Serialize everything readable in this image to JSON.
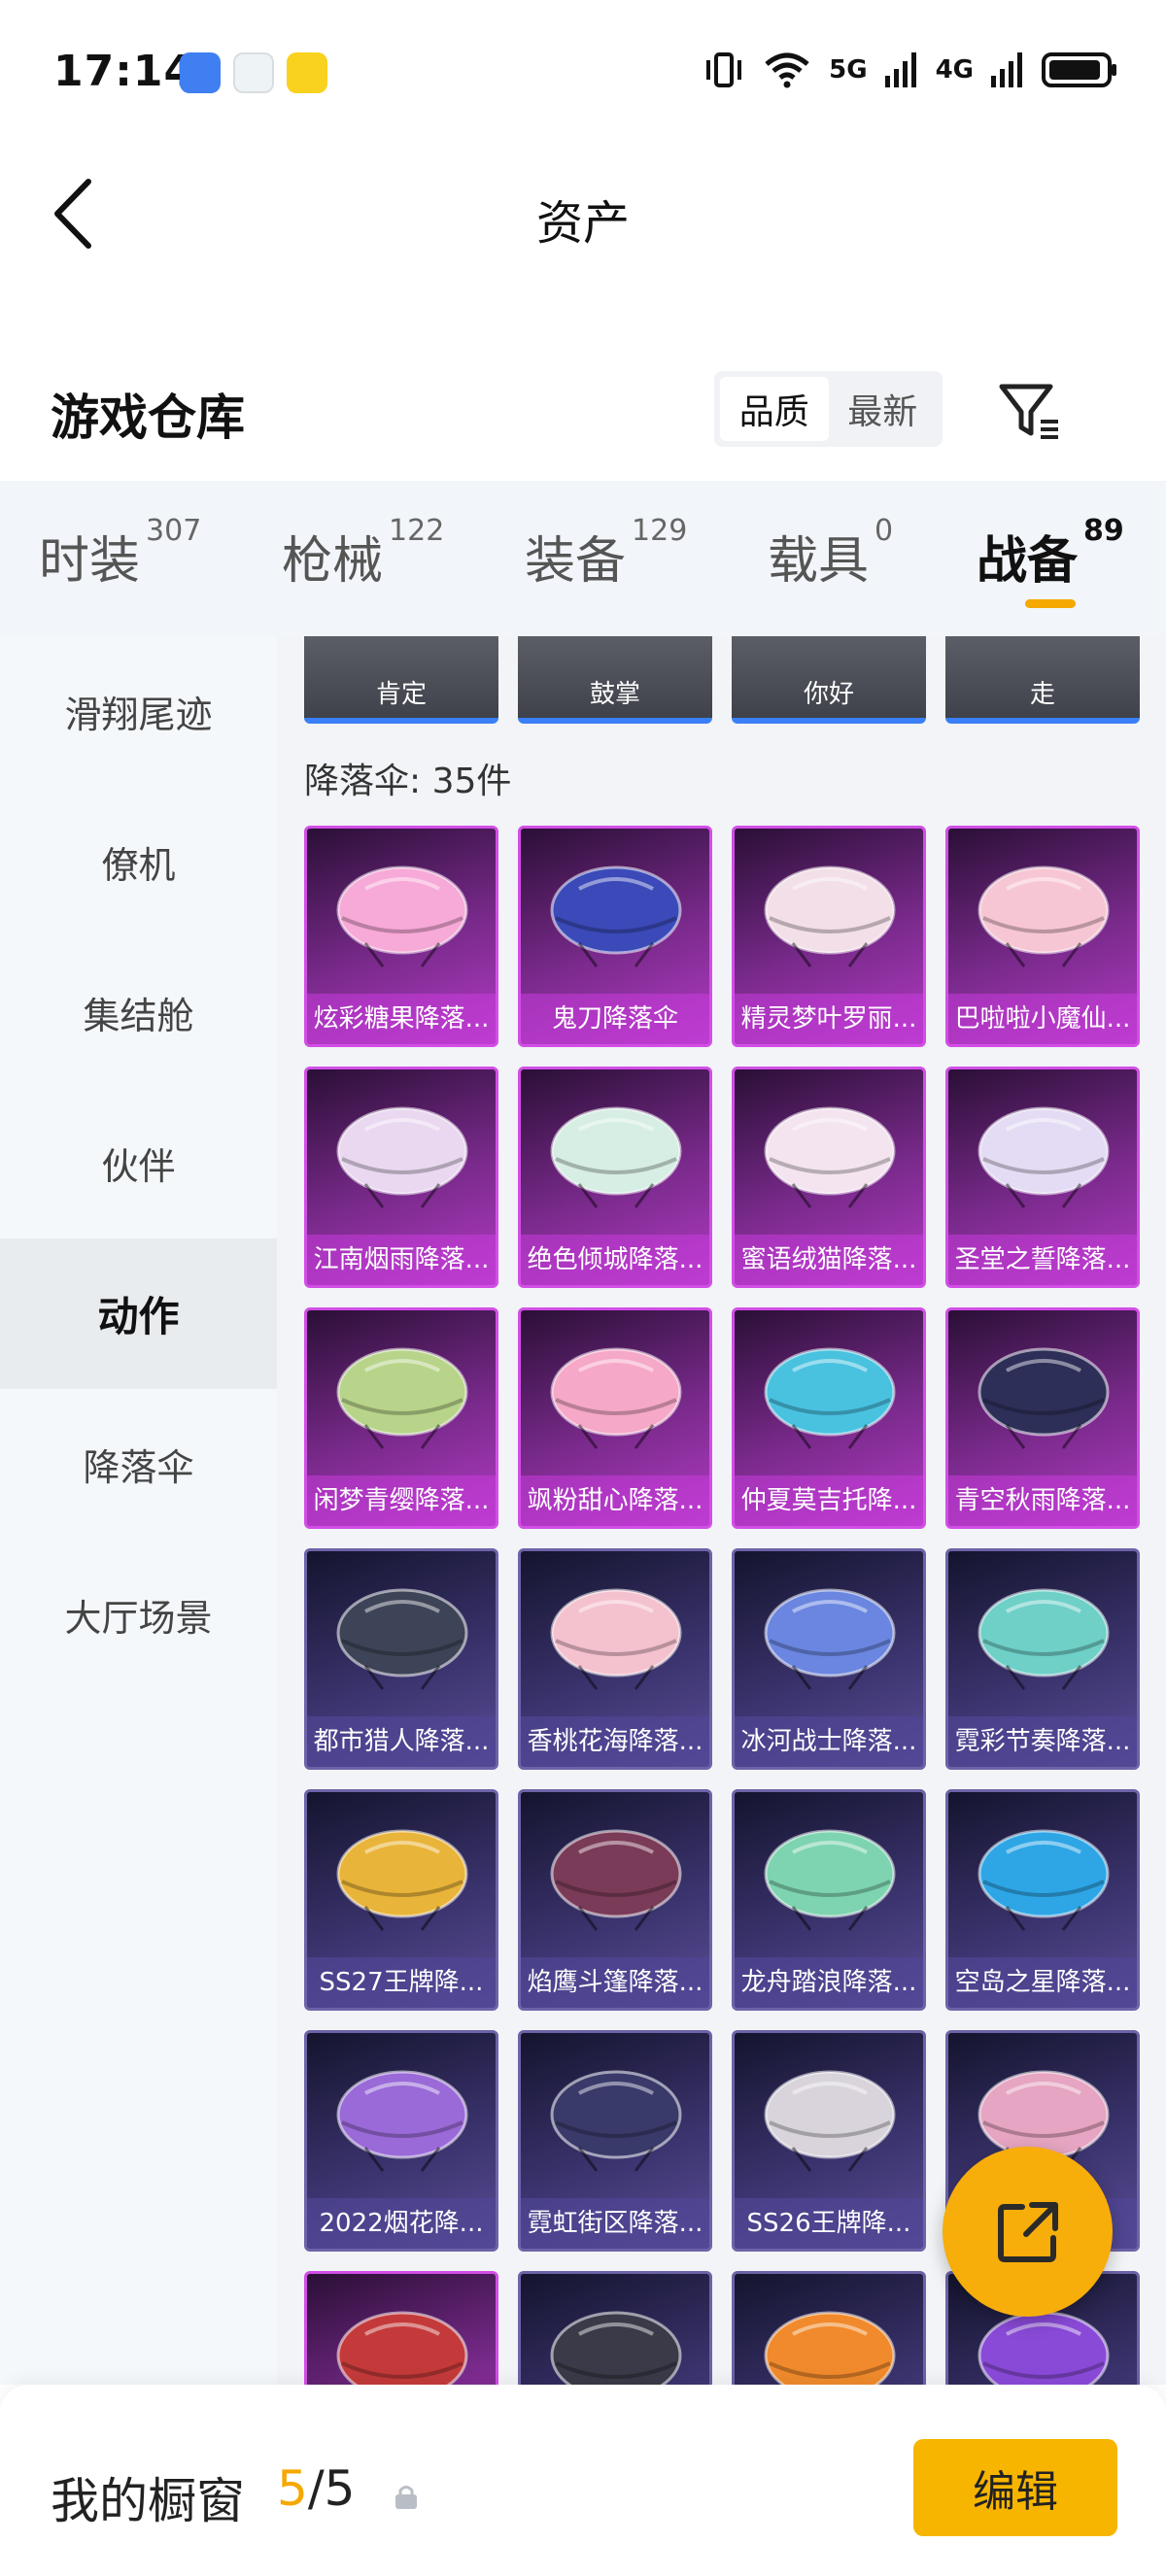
{
  "status_bar": {
    "time": "17:14",
    "network_1": "5G",
    "network_2": "4G",
    "app_icons": [
      "app-icon-blue",
      "app-icon-white",
      "app-icon-yellow"
    ]
  },
  "header": {
    "title": "资产"
  },
  "warehouse": {
    "title": "游戏仓库",
    "sort_options": [
      "品质",
      "最新"
    ],
    "active_sort": "品质"
  },
  "category_tabs": [
    {
      "label": "时装",
      "count": "307"
    },
    {
      "label": "枪械",
      "count": "122"
    },
    {
      "label": "装备",
      "count": "129"
    },
    {
      "label": "载具",
      "count": "0"
    },
    {
      "label": "战备",
      "count": "89"
    }
  ],
  "active_category": "战备",
  "sidebar": {
    "items": [
      "滑翔尾迹",
      "僚机",
      "集结舱",
      "伙伴",
      "动作",
      "降落伞",
      "大厅场景"
    ],
    "active": "动作"
  },
  "emotes": [
    "肯定",
    "鼓掌",
    "你好",
    "走"
  ],
  "section_count_label": "降落伞: 35件",
  "items": [
    {
      "name": "炫彩糖果降落...",
      "rarity": "legend",
      "color": "#f7a9d8"
    },
    {
      "name": "鬼刀降落伞",
      "rarity": "legend",
      "color": "#3b4ab8"
    },
    {
      "name": "精灵梦叶罗丽...",
      "rarity": "legend",
      "color": "#f3dfe8"
    },
    {
      "name": "巴啦啦小魔仙...",
      "rarity": "legend",
      "color": "#f7c6d4"
    },
    {
      "name": "江南烟雨降落...",
      "rarity": "legend",
      "color": "#e9d8f0"
    },
    {
      "name": "绝色倾城降落...",
      "rarity": "legend",
      "color": "#d7eee4"
    },
    {
      "name": "蜜语绒猫降落...",
      "rarity": "legend",
      "color": "#f4e4f0"
    },
    {
      "name": "圣堂之誓降落...",
      "rarity": "legend",
      "color": "#e4dcf4"
    },
    {
      "name": "闲梦青缨降落...",
      "rarity": "legend",
      "color": "#b8d48a"
    },
    {
      "name": "飒粉甜心降落...",
      "rarity": "legend",
      "color": "#f6a8c8"
    },
    {
      "name": "仲夏莫吉托降...",
      "rarity": "legend",
      "color": "#49c2e0"
    },
    {
      "name": "青空秋雨降落...",
      "rarity": "legend",
      "color": "#2d2f58"
    },
    {
      "name": "都市猎人降落...",
      "rarity": "epic",
      "color": "#3e4457"
    },
    {
      "name": "香桃花海降落...",
      "rarity": "epic",
      "color": "#f4c2cf"
    },
    {
      "name": "冰河战士降落...",
      "rarity": "epic",
      "color": "#6a86e0"
    },
    {
      "name": "霓彩节奏降落...",
      "rarity": "epic",
      "color": "#6fd0c8"
    },
    {
      "name": "SS27王牌降...",
      "rarity": "epic",
      "color": "#e9b43a"
    },
    {
      "name": "焰鹰斗篷降落...",
      "rarity": "epic",
      "color": "#7a3b58"
    },
    {
      "name": "龙舟踏浪降落...",
      "rarity": "epic",
      "color": "#7ed4b0"
    },
    {
      "name": "空岛之星降落...",
      "rarity": "epic",
      "color": "#2ea6e6"
    },
    {
      "name": "2022烟花降...",
      "rarity": "epic",
      "color": "#9a6ad8"
    },
    {
      "name": "霓虹街区降落...",
      "rarity": "epic",
      "color": "#3a3a6a"
    },
    {
      "name": "SS26王牌降...",
      "rarity": "epic",
      "color": "#d9d4dc"
    },
    {
      "name": "",
      "rarity": "epic",
      "color": "#e6a5c2"
    },
    {
      "name": "",
      "rarity": "legend",
      "color": "#c43a3a"
    },
    {
      "name": "",
      "rarity": "epic",
      "color": "#3a3a48"
    },
    {
      "name": "",
      "rarity": "epic",
      "color": "#f08a2c"
    },
    {
      "name": "",
      "rarity": "epic",
      "color": "#8a4ad8"
    }
  ],
  "showcase": {
    "title": "我的橱窗",
    "used": "5",
    "separator": "/",
    "total": "5",
    "edit_label": "编辑"
  },
  "colors": {
    "accent": "#f7b500",
    "legend_border": "#d24ee6",
    "epic_border": "#6c63a8"
  }
}
